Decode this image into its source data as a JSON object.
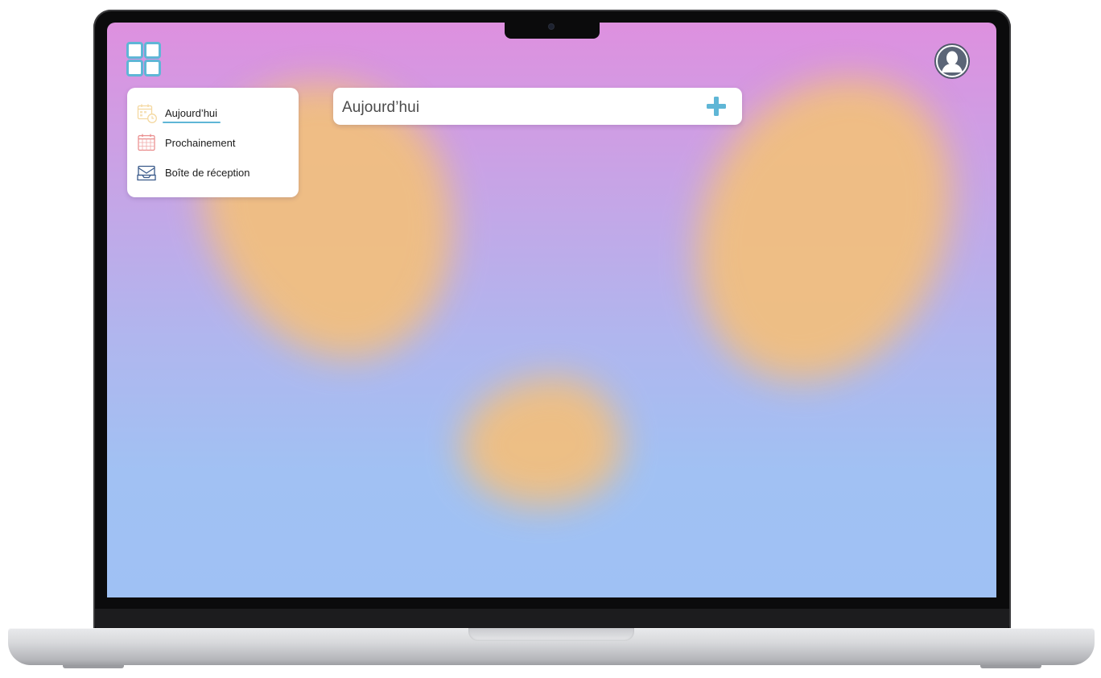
{
  "sidebar": {
    "items": [
      {
        "label": "Aujourd’hui",
        "icon": "calendar-clock-icon",
        "active": true
      },
      {
        "label": "Prochainement",
        "icon": "calendar-grid-icon",
        "active": false
      },
      {
        "label": "Boîte de réception",
        "icon": "inbox-icon",
        "active": false
      }
    ]
  },
  "main": {
    "title": "Aujourd’hui",
    "add_icon": "plus-icon"
  },
  "header": {
    "apps_icon": "apps-grid-icon",
    "avatar_icon": "user-avatar-icon"
  },
  "colors": {
    "accent": "#5fb6d6",
    "background_top": "#de90df",
    "background_bottom": "#9fc1f4",
    "blob": "#f1bf80",
    "avatar": "#5b6577"
  }
}
